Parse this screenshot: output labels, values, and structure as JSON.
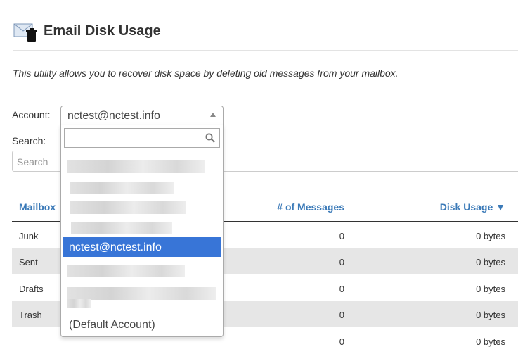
{
  "page": {
    "title": "Email Disk Usage",
    "description": "This utility allows you to recover disk space by deleting old messages from your mailbox."
  },
  "account": {
    "label": "Account:",
    "selected": "nctest@nctest.info",
    "options": [
      {
        "text": "",
        "redacted": true
      },
      {
        "text": "",
        "redacted": true
      },
      {
        "text": "",
        "redacted": true
      },
      {
        "text": "",
        "redacted": true
      },
      {
        "text": "nctest@nctest.info",
        "selected": true
      },
      {
        "text": "",
        "redacted": true
      },
      {
        "text": "",
        "redacted": true
      },
      {
        "text": "(Default Account)"
      }
    ]
  },
  "search": {
    "label": "Search:",
    "placeholder": "Search"
  },
  "table": {
    "headers": {
      "mailbox": "Mailbox",
      "messages": "# of Messages",
      "usage": "Disk Usage ▼"
    },
    "rows": [
      {
        "mailbox": "Junk",
        "messages": "0",
        "usage": "0 bytes"
      },
      {
        "mailbox": "Sent",
        "messages": "0",
        "usage": "0 bytes"
      },
      {
        "mailbox": "Drafts",
        "messages": "0",
        "usage": "0 bytes"
      },
      {
        "mailbox": "Trash",
        "messages": "0",
        "usage": "0 bytes"
      },
      {
        "mailbox": "",
        "messages": "0",
        "usage": "0 bytes"
      }
    ]
  },
  "colors": {
    "link": "#3b7ab8",
    "selected_option": "#3875d7",
    "row_alt": "#e6e6e6"
  },
  "icons": {
    "header": "email-trash-icon",
    "dropdown_search": "search-icon",
    "sort": "sort-desc-icon"
  }
}
